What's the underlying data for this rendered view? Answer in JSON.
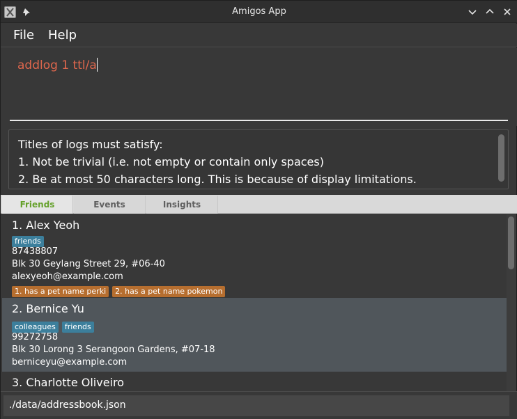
{
  "window": {
    "title": "Amigos App",
    "accent": "#66a12c",
    "command_color": "#e0674d",
    "tag_color": "#3c7f9c",
    "log_color": "#b66e2f"
  },
  "menu": {
    "file": "File",
    "help": "Help"
  },
  "command": {
    "value": "addlog 1 ttl/a"
  },
  "result": {
    "lines": [
      "Titles of logs must satisfy:",
      "1. Not be trivial (i.e. not empty or contain only spaces)",
      "2. Be at most 50 characters long. This is because of display limitations."
    ]
  },
  "tabs": [
    {
      "label": "Friends",
      "selected": true
    },
    {
      "label": "Events",
      "selected": false
    },
    {
      "label": "Insights",
      "selected": false
    }
  ],
  "friends": [
    {
      "name": "1.  Alex Yeoh",
      "tags": [
        "friends"
      ],
      "phone": "87438807",
      "address": "Blk 30 Geylang Street 29, #06-40",
      "email": "alexyeoh@example.com",
      "logs": [
        "1. has a pet name perki",
        "2. has a pet name pokemon"
      ]
    },
    {
      "name": "2.  Bernice Yu",
      "tags": [
        "colleagues",
        "friends"
      ],
      "phone": "99272758",
      "address": "Blk 30 Lorong 3 Serangoon Gardens, #07-18",
      "email": "berniceyu@example.com",
      "logs": []
    },
    {
      "name": "3.  Charlotte Oliveiro"
    }
  ],
  "status": {
    "path": "./data/addressbook.json"
  }
}
